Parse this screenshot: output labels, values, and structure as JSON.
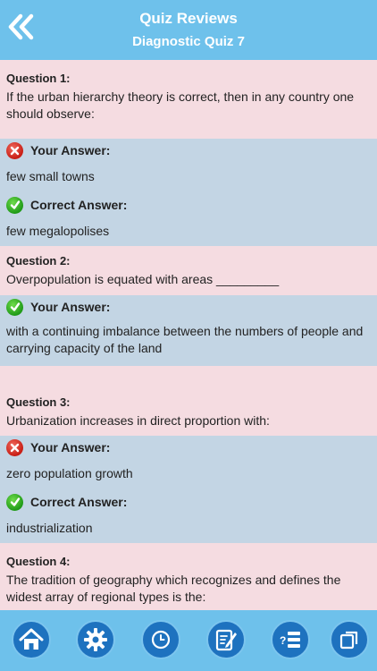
{
  "header": {
    "title": "Quiz Reviews",
    "subtitle": "Diagnostic Quiz 7"
  },
  "questions": [
    {
      "label": "Question 1:",
      "text": "If the urban hierarchy theory is correct, then in any country one should observe:",
      "your_answer_label": "Your Answer:",
      "your_answer": "few small towns",
      "your_answer_status": "wrong",
      "correct_answer_label": "Correct Answer:",
      "correct_answer": "few megalopolises"
    },
    {
      "label": "Question 2:",
      "text": "Overpopulation is equated with areas _________",
      "your_answer_label": "Your Answer:",
      "your_answer": "with a continuing imbalance between the numbers of people and carrying capacity of the land",
      "your_answer_status": "correct"
    },
    {
      "label": "Question 3:",
      "text": "Urbanization increases in direct proportion with:",
      "your_answer_label": "Your Answer:",
      "your_answer": "zero population growth",
      "your_answer_status": "wrong",
      "correct_answer_label": "Correct Answer:",
      "correct_answer": "industrialization"
    },
    {
      "label": "Question 4:",
      "text": "The tradition of geography which recognizes and defines the widest array of regional types is the:"
    }
  ],
  "footer": {
    "buttons": [
      "home-icon",
      "gear-icon",
      "clock-icon",
      "notepad-icon",
      "quiz-list-icon",
      "copy-icon"
    ]
  },
  "colors": {
    "header_bg": "#6ec1eb",
    "question_bg": "#f5dce1",
    "answer_bg": "#c3d5e4",
    "nav_button": "#1e72bf",
    "wrong": "#c81d14",
    "correct": "#1f9a17"
  }
}
